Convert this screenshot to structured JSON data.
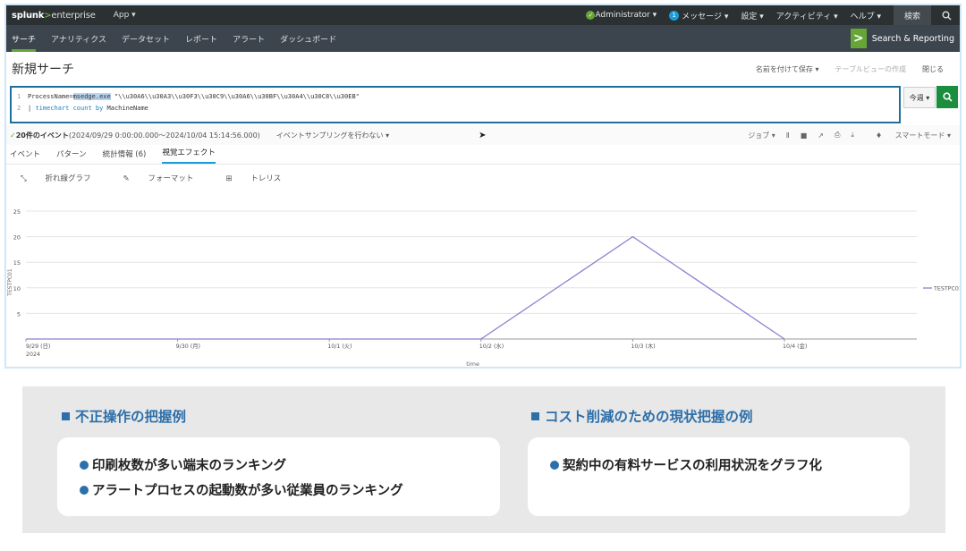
{
  "splunk": {
    "logo_brand": "splunk",
    "logo_gt": ">",
    "logo_suffix": "enterprise",
    "app_menu": "App ▾",
    "top_nav": {
      "admin": "Administrator ▾",
      "message_count": "1",
      "messages": "メッセージ ▾",
      "settings": "設定 ▾",
      "activity": "アクティビティ ▾",
      "help": "ヘルプ ▾",
      "search": "検索"
    },
    "app_nav": [
      "サーチ",
      "アナリティクス",
      "データセット",
      "レポート",
      "アラート",
      "ダッシュボード"
    ],
    "app_brand_label": "Search & Reporting",
    "page_title": "新規サーチ",
    "title_actions": {
      "save_as": "名前を付けて保存 ▾",
      "create_table": "テーブルビューの作成",
      "close": "閉じる"
    },
    "query": {
      "line1_num": "1",
      "line1_prefix": "ProcessName=",
      "line1_highlight": "msedge.exe",
      "line1_rest": " \"\\\\u30A6\\\\u30A3\\\\u30F3\\\\u30C9\\\\u30A6\\\\u30BF\\\\u30A4\\\\u30C8\\\\u30EB\"",
      "line2_num": "2",
      "line2_pipe": "| ",
      "line2_cmd": "timechart",
      "line2_fn": " count",
      "line2_by": " by",
      "line2_field": " MachineName"
    },
    "time_picker": "今週 ▾",
    "status": {
      "count": "20件のイベント",
      "range": " (2024/09/29 0:00:00.000～2024/10/04 15:14:56.000)",
      "sampling": "イベントサンプリングを行わない ▾",
      "job": "ジョブ ▾",
      "smart_mode": "スマートモード ▾"
    },
    "tabs": [
      "イベント",
      "パターン",
      "統計情報 (6)",
      "視覚エフェクト"
    ],
    "viz_options": [
      "折れ線グラフ",
      "フォーマット",
      "トレリス"
    ]
  },
  "chart_data": {
    "type": "line",
    "x": [
      "9/29 (日)",
      "9/30 (月)",
      "10/1 (火)",
      "10/2 (水)",
      "10/3 (木)",
      "10/4 (金)"
    ],
    "x_year": "2024",
    "series": [
      {
        "name": "TESTPC01",
        "values": [
          0,
          0,
          0,
          0,
          20,
          0
        ]
      }
    ],
    "ylabel": "TESTPC01",
    "xlabel": "_time",
    "ylim": [
      0,
      25
    ],
    "yticks": [
      5,
      10,
      15,
      20,
      25
    ],
    "grid": true,
    "legend": "right",
    "line_color": "#8c7fd0"
  },
  "panel": {
    "left_heading": "不正操作の把握例",
    "left_items": [
      "印刷枚数が多い端末のランキング",
      "アラートプロセスの起動数が多い従業員のランキング"
    ],
    "right_heading": "コスト削減のための現状把握の例",
    "right_items": [
      "契約中の有料サービスの利用状況をグラフ化"
    ],
    "accent_color": "#2d6faa"
  }
}
